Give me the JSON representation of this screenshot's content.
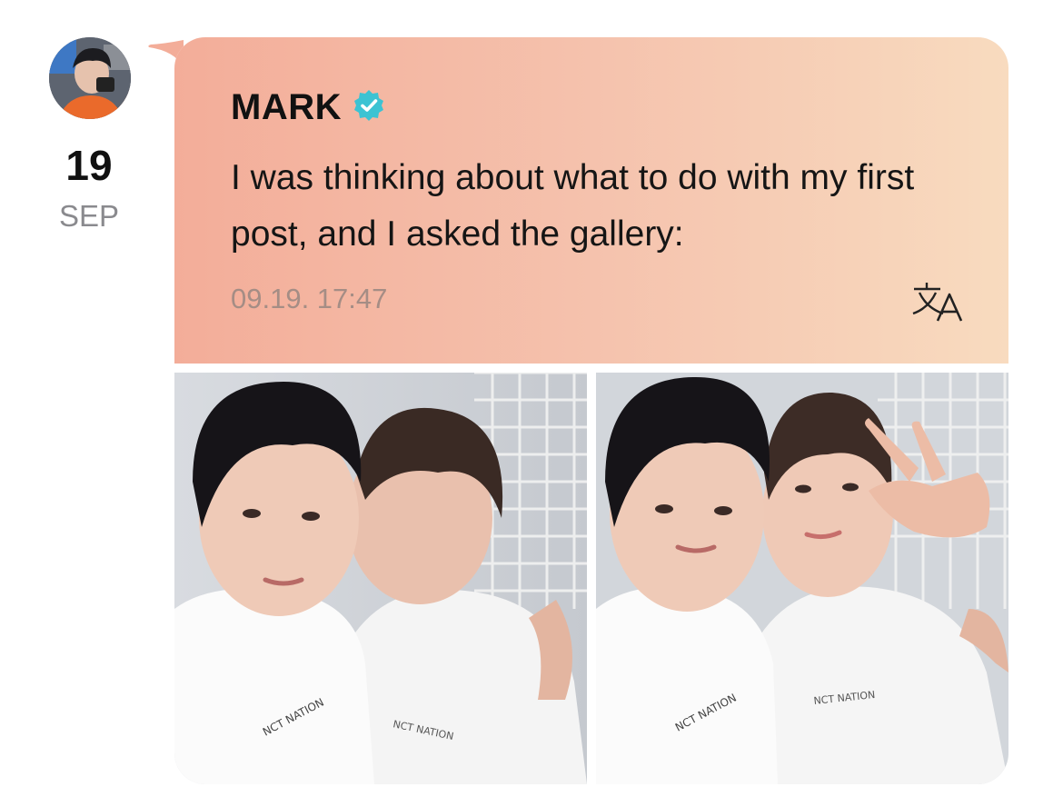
{
  "post": {
    "author": "MARK",
    "verified": true,
    "text": "I was thinking about what to do with my first post, and I asked the gallery:",
    "timestamp": "09.19. 17:47",
    "date_day": "19",
    "date_month": "SEP"
  },
  "icons": {
    "verified": "verified-badge-icon",
    "translate": "translate-icon"
  },
  "colors": {
    "bubble_gradient_start": "#f3ad99",
    "bubble_gradient_end": "#f8dbbf",
    "verified_badge": "#3cc3d3",
    "timestamp": "#a58d85",
    "date_month": "#8a8a8e"
  },
  "photos": [
    {
      "name": "photo-1"
    },
    {
      "name": "photo-2"
    }
  ]
}
